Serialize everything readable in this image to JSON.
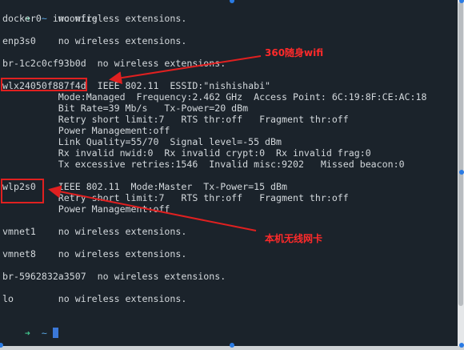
{
  "terminal": {
    "prompt_arrow": "➜",
    "prompt_tilde": "~",
    "command": "iwconfig",
    "lines": [
      "docker0   no wireless extensions.",
      "",
      "enp3s0    no wireless extensions.",
      "",
      "br-1c2c0cf93b0d  no wireless extensions.",
      "",
      "wlx24050f887f4d  IEEE 802.11  ESSID:\"nishishabi\"",
      "          Mode:Managed  Frequency:2.462 GHz  Access Point: 6C:19:8F:CE:AC:18",
      "          Bit Rate=39 Mb/s   Tx-Power=20 dBm",
      "          Retry short limit:7   RTS thr:off   Fragment thr:off",
      "          Power Management:off",
      "          Link Quality=55/70  Signal level=-55 dBm",
      "          Rx invalid nwid:0  Rx invalid crypt:0  Rx invalid frag:0",
      "          Tx excessive retries:1546  Invalid misc:9202   Missed beacon:0",
      "",
      "wlp2s0    IEEE 802.11  Mode:Master  Tx-Power=15 dBm",
      "          Retry short limit:7   RTS thr:off   Fragment thr:off",
      "          Power Management:off",
      "",
      "vmnet1    no wireless extensions.",
      "",
      "vmnet8    no wireless extensions.",
      "",
      "br-5962832a3507  no wireless extensions.",
      "",
      "lo        no wireless extensions.",
      ""
    ]
  },
  "annotations": {
    "wifi_360": "360随身wifi",
    "local_nic": "本机无线网卡",
    "color": "#e02020"
  }
}
